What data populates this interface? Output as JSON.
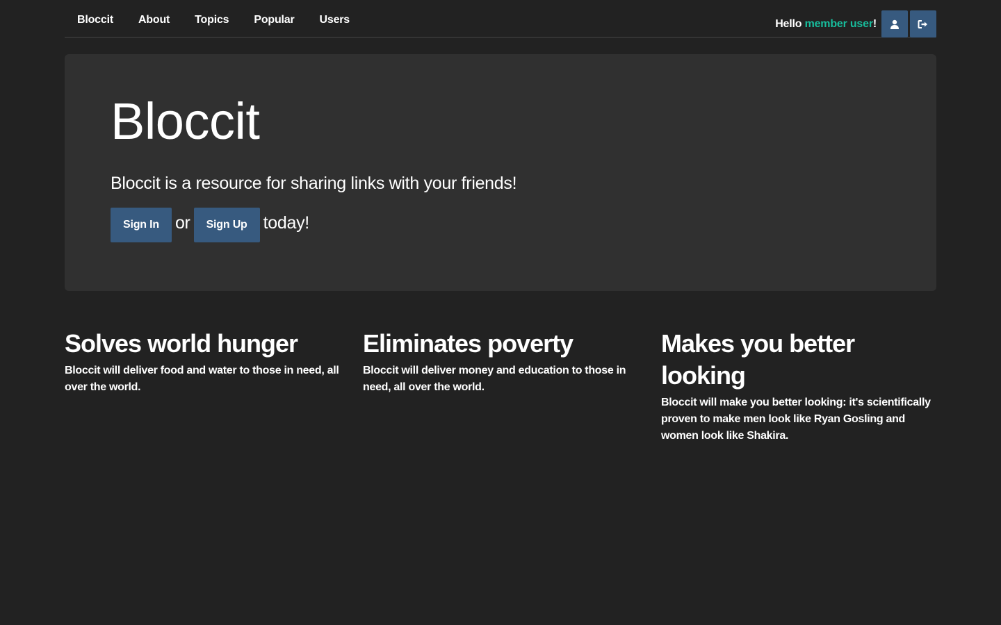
{
  "nav": {
    "links": [
      "Bloccit",
      "About",
      "Topics",
      "Popular",
      "Users"
    ],
    "greeting_prefix": "Hello ",
    "user_name": "member user",
    "greeting_suffix": "!",
    "profile_icon": "user-icon",
    "logout_icon": "sign-out-icon"
  },
  "jumbotron": {
    "title": "Bloccit",
    "lead": "Bloccit is a resource for sharing links with your friends!",
    "sign_in_label": "Sign In",
    "or_text": "or",
    "sign_up_label": "Sign Up",
    "today_text": "today!"
  },
  "features": [
    {
      "title": "Solves world hunger",
      "body": "Bloccit will deliver food and water to those in need, all over the world."
    },
    {
      "title": "Eliminates poverty",
      "body": "Bloccit will deliver money and education to those in need, all over the world."
    },
    {
      "title": "Makes you better looking",
      "body": "Bloccit will make you better looking: it's scientifically proven to make men look like Ryan Gosling and women look like Shakira."
    }
  ],
  "colors": {
    "background": "#222222",
    "jumbotron": "#303030",
    "button": "#375a7f",
    "accent": "#18bc9c"
  }
}
